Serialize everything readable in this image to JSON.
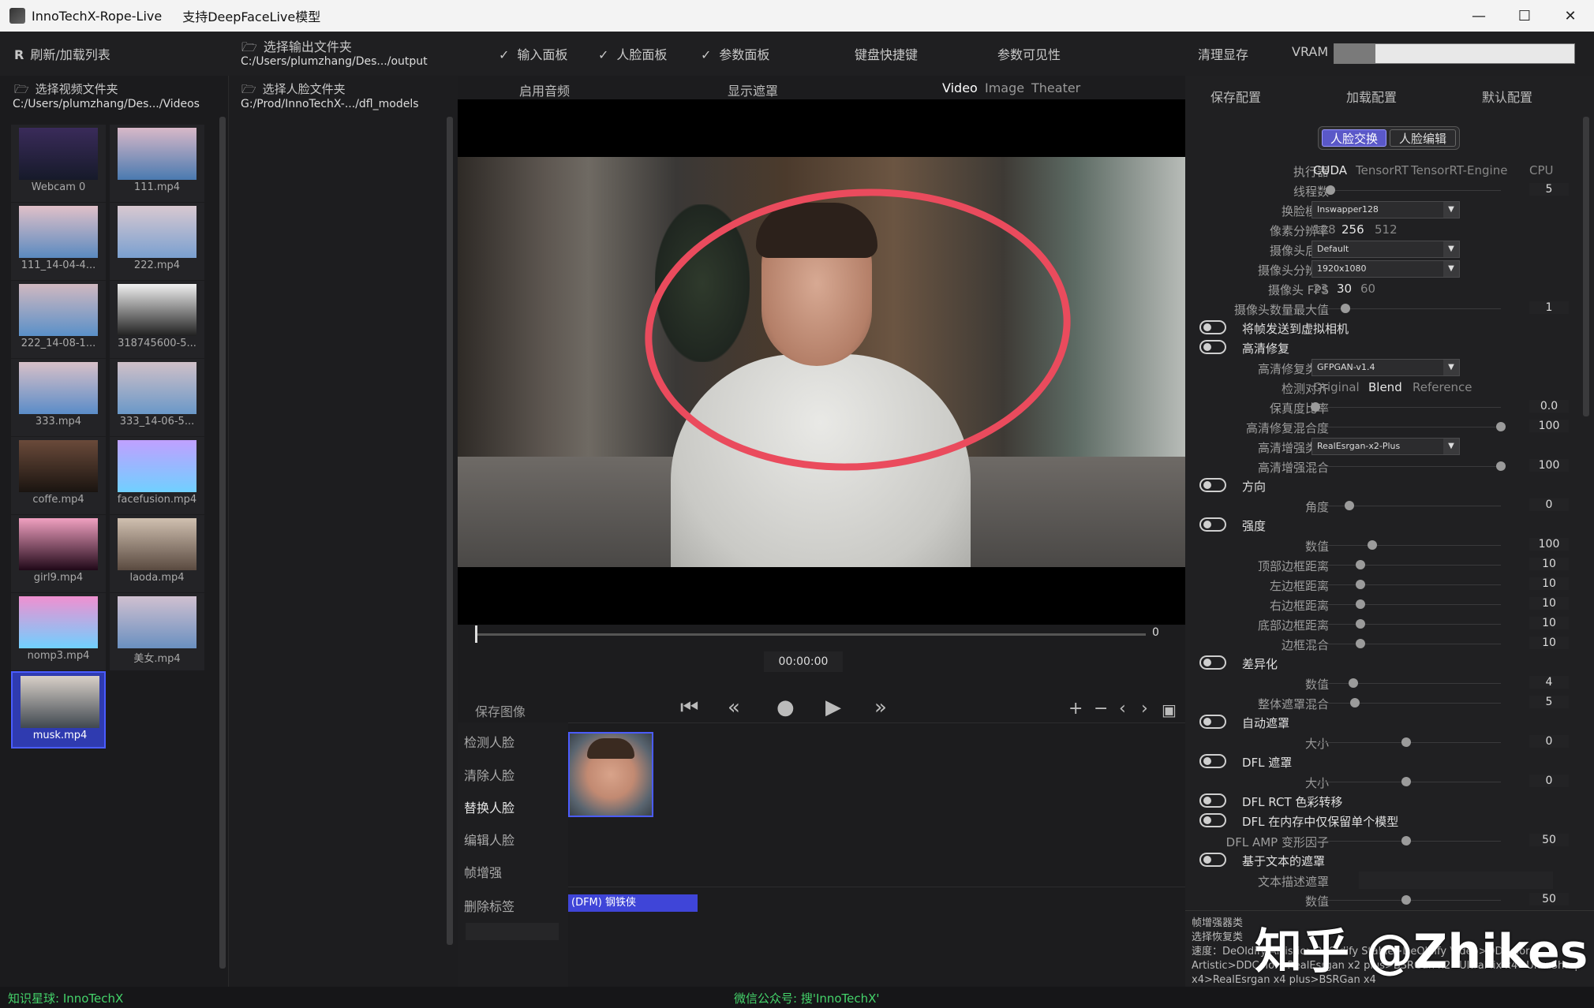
{
  "window": {
    "app_title": "InnoTechX-Rope-Live",
    "subtitle": "支持DeepFaceLive模型",
    "minimize": "—",
    "maximize": "☐",
    "close": "✕"
  },
  "topbar": {
    "refresh": "刷新/加载列表",
    "output_label": "选择输出文件夹",
    "output_path": "C:/Users/plumzhang/Des.../output",
    "input_panel": "输入面板",
    "face_panel": "人脸面板",
    "param_panel": "参数面板",
    "shortcuts": "键盘快捷键",
    "param_visibility": "参数可见性",
    "clear_vram": "清理显存",
    "vram_label": "VRAM",
    "vram_usage": 0.17,
    "check": "✓"
  },
  "left": {
    "video_folder_label": "选择视频文件夹",
    "video_folder_path": "C:/Users/plumzhang/Des.../Videos",
    "face_folder_label": "选择人脸文件夹",
    "face_folder_path": "G:/Prod/InnoTechX-.../dfl_models",
    "thumbs": [
      "Webcam 0",
      "111.mp4",
      "111_14-04-4...",
      "222.mp4",
      "222_14-08-1...",
      "318745600-5...",
      "333.mp4",
      "333_14-06-5...",
      "coffe.mp4",
      "facefusion.mp4",
      "girl9.mp4",
      "laoda.mp4",
      "nomp3.mp4",
      "美女.mp4",
      "musk.mp4"
    ]
  },
  "center": {
    "audio": "启用音频",
    "show_mask": "显示遮罩",
    "view_video": "Video",
    "view_image": "Image",
    "view_theater": "Theater",
    "frame_num": "0",
    "timecode": "00:00:00",
    "save_image": "保存图像",
    "side": [
      "检测人脸",
      "清除人脸",
      "替换人脸",
      "编辑人脸",
      "帧增强",
      "删除标签"
    ],
    "face_tag": "(DFM) 钢铁侠"
  },
  "right": {
    "save_cfg": "保存配置",
    "load_cfg": "加载配置",
    "default_cfg": "默认配置",
    "tab_swap": "人脸交换",
    "tab_edit": "人脸编辑",
    "executor": "执行器",
    "exec_opts": [
      "CUDA",
      "TensorRT",
      "TensorRT-Engine",
      "CPU"
    ],
    "threads": "线程数",
    "threads_val": "5",
    "swap_model": "换脸模型",
    "swap_model_val": "Inswapper128",
    "pixel_res": "像素分辨率",
    "res_opts": [
      "128",
      "256",
      "512"
    ],
    "cam_backend": "摄像头后端",
    "cam_backend_val": "Default",
    "cam_res": "摄像头分辨率",
    "cam_res_val": "1920x1080",
    "cam_fps": "摄像头 FPS",
    "fps_opts": [
      "23",
      "30",
      "60"
    ],
    "cam_max": "摄像头数量最大值",
    "cam_max_val": "1",
    "virtual_cam": "将帧发送到虚拟相机",
    "restore": "高清修复",
    "restore_type": "高清修复类型",
    "restore_type_val": "GFPGAN-v1.4",
    "align": "检测对齐",
    "align_opts": [
      "Original",
      "Blend",
      "Reference"
    ],
    "fidelity": "保真度比率",
    "fidelity_val": "0.0",
    "restore_blend": "高清修复混合度",
    "restore_blend_val": "100",
    "enhance_type": "高清增强类型",
    "enhance_type_val": "RealEsrgan-x2-Plus",
    "enhance_blend": "高清增强混合",
    "enhance_blend_val": "100",
    "orientation": "方向",
    "angle": "角度",
    "angle_val": "0",
    "strength": "强度",
    "amount": "数值",
    "amount_val": "100",
    "top_border": "顶部边框距离",
    "left_border": "左边框距离",
    "right_border": "右边框距离",
    "bottom_border": "底部边框距离",
    "border_blend": "边框混合",
    "border_val": "10",
    "diff": "差异化",
    "diff_val": "4",
    "overall_mask": "整体遮罩混合",
    "overall_val": "5",
    "auto_mask": "自动遮罩",
    "size": "大小",
    "size_val": "0",
    "dfl_mask": "DFL 遮罩",
    "dfl_rct": "DFL RCT 色彩转移",
    "dfl_single": "DFL 在内存中仅保留单个模型",
    "dfl_amp": "DFL AMP 变形因子",
    "dfl_amp_val": "50",
    "text_mask": "基于文本的遮罩",
    "text_desc": "文本描述遮罩",
    "text_amount_val": "50",
    "info": "帧增强器类\n选择恢复类\n速度：DeOldify Artistic>DeOldify Stable>DeOldify Video>DDColor Artistic>DDColor>RealEsrgan x2 plus>BSRGan x2>UltraMix x4>UltraSharp x4>RealEsrgan x4 plus>BSRGan x4"
  },
  "watermark": "知乎 @Zhikes",
  "status": {
    "left": "知识星球: InnoTechX",
    "center": "微信公众号: 搜'InnoTechX'"
  }
}
